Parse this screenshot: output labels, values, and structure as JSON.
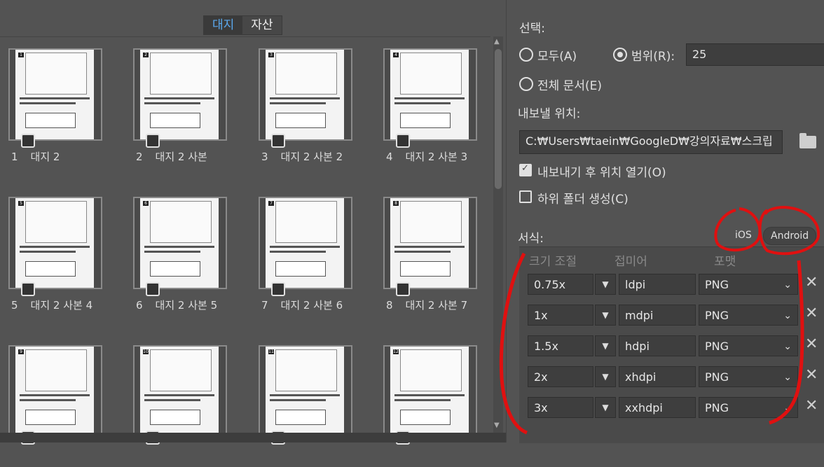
{
  "tabs": {
    "artboard": "대지",
    "assets": "자산"
  },
  "thumbnails": [
    {
      "num": "1",
      "name": "대지 2"
    },
    {
      "num": "2",
      "name": "대지 2 사본"
    },
    {
      "num": "3",
      "name": "대지 2 사본 2"
    },
    {
      "num": "4",
      "name": "대지 2 사본 3"
    },
    {
      "num": "5",
      "name": "대지 2 사본 4"
    },
    {
      "num": "6",
      "name": "대지 2 사본 5"
    },
    {
      "num": "7",
      "name": "대지 2 사본 6"
    },
    {
      "num": "8",
      "name": "대지 2 사본 7"
    },
    {
      "num": "9",
      "name": ""
    },
    {
      "num": "10",
      "name": ""
    },
    {
      "num": "11",
      "name": ""
    },
    {
      "num": "12",
      "name": ""
    }
  ],
  "selection": {
    "label": "선택:",
    "all": "모두(A)",
    "range": "범위(R):",
    "range_value": "25",
    "whole_doc": "전체 문서(E)"
  },
  "export": {
    "location_label": "내보낼 위치:",
    "path": "C:₩Users₩taein₩GoogleD₩강의자료₩스크립",
    "open_after": "내보내기 후 위치 열기(O)",
    "create_subfolder": "하위 폴더 생성(C)"
  },
  "format": {
    "label": "서식:",
    "ios": "iOS",
    "android": "Android",
    "col_scale": "크기 조절",
    "col_suffix": "접미어",
    "col_format": "포맷",
    "rows": [
      {
        "scale": "0.75x",
        "suffix": "ldpi",
        "fmt": "PNG"
      },
      {
        "scale": "1x",
        "suffix": "mdpi",
        "fmt": "PNG"
      },
      {
        "scale": "1.5x",
        "suffix": "hdpi",
        "fmt": "PNG"
      },
      {
        "scale": "2x",
        "suffix": "xhdpi",
        "fmt": "PNG"
      },
      {
        "scale": "3x",
        "suffix": "xxhdpi",
        "fmt": "PNG"
      }
    ]
  },
  "annotation_color": "#e01010"
}
